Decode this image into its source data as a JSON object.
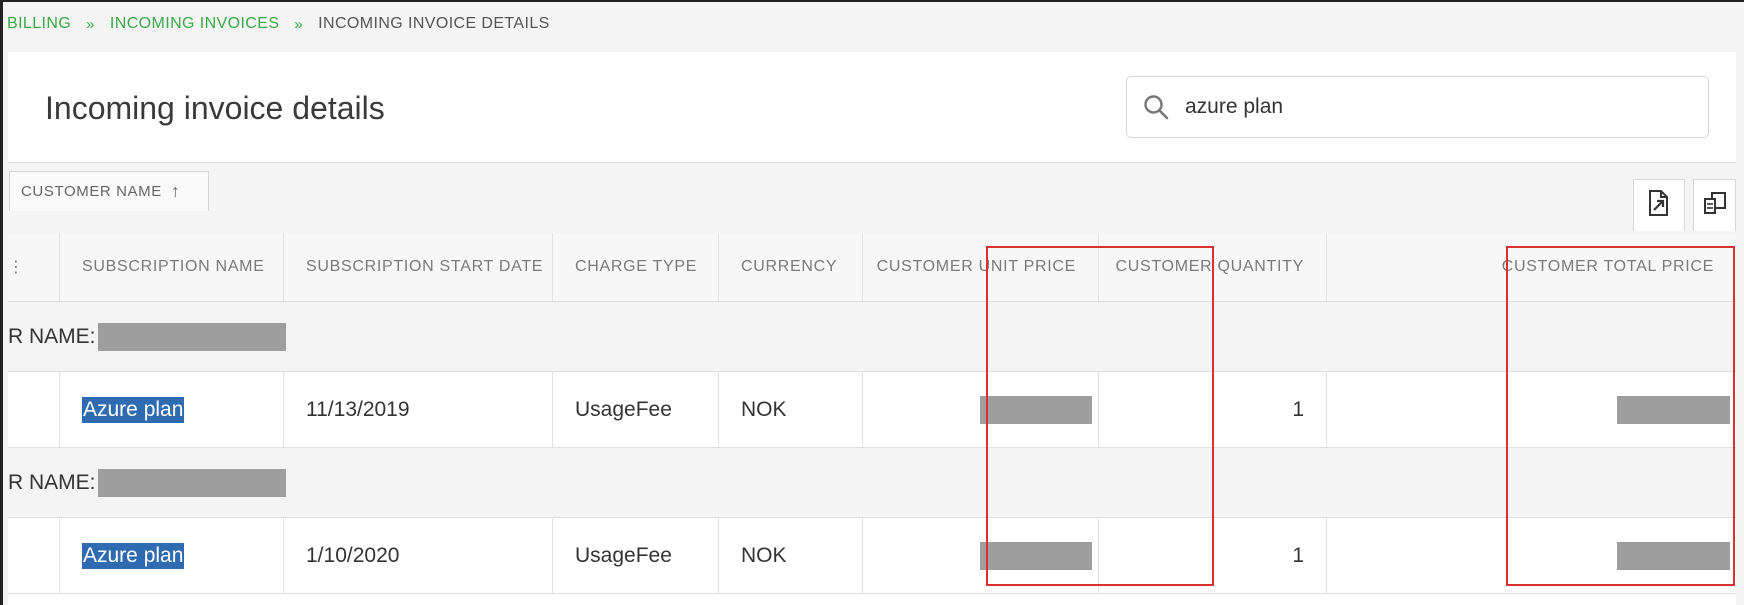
{
  "breadcrumb": {
    "items": [
      "BILLING",
      "INCOMING INVOICES"
    ],
    "separator": "»",
    "current": "INCOMING INVOICE DETAILS"
  },
  "page": {
    "title": "Incoming invoice details"
  },
  "search": {
    "value": "azure plan",
    "icon": "search-icon"
  },
  "grouping": {
    "chip_label": "CUSTOMER NAME",
    "chip_sort": "↑"
  },
  "toolbar": {
    "export_icon": "export-icon",
    "columns_icon": "columns-icon"
  },
  "table": {
    "columns": [
      "SUBSCRIPTION NAME",
      "SUBSCRIPTION START DATE",
      "CHARGE TYPE",
      "CURRENCY",
      "CUSTOMER UNIT PRICE",
      "CUSTOMER QUANTITY",
      "CUSTOMER TOTAL PRICE"
    ],
    "group_prefix": "R NAME:",
    "rows": [
      {
        "subscription_name": "Azure plan",
        "start_date": "11/13/2019",
        "charge_type": "UsageFee",
        "currency": "NOK",
        "quantity": "1"
      },
      {
        "subscription_name": "Azure plan",
        "start_date": "1/10/2020",
        "charge_type": "UsageFee",
        "currency": "NOK",
        "quantity": "1"
      }
    ]
  },
  "colors": {
    "link_green": "#3aa849",
    "selection_blue": "#2f6bb0",
    "annotation_red": "#d93030",
    "redaction_gray": "#9e9e9e"
  }
}
